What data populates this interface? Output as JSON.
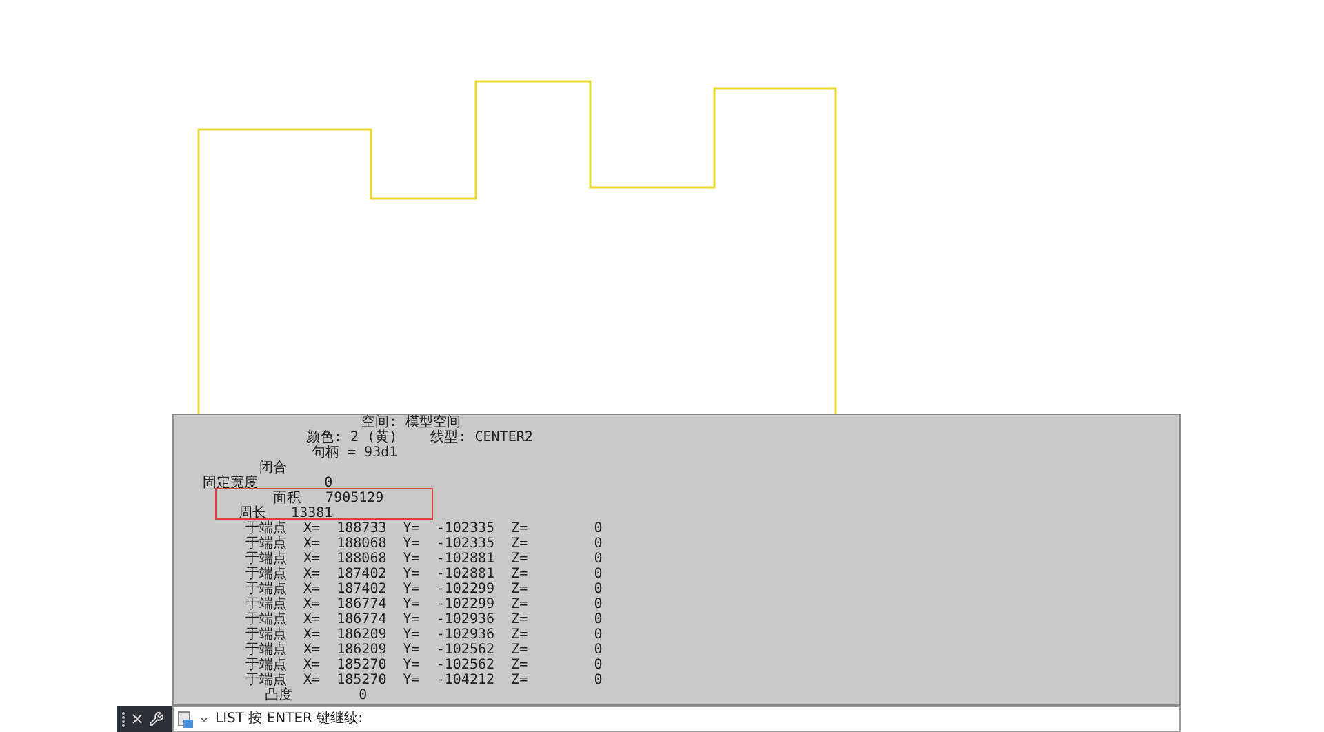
{
  "listing": {
    "lines": [
      {
        "kind": "space",
        "text": "空间: 模型空间"
      },
      {
        "kind": "color",
        "text": "颜色: 2 (黄)    线型: CENTER2"
      },
      {
        "kind": "handle",
        "text": "句柄 = 93d1"
      },
      {
        "kind": "closed",
        "text": "闭合"
      },
      {
        "kind": "width",
        "text": "固定宽度        0"
      },
      {
        "kind": "area",
        "text": "面积   7905129"
      },
      {
        "kind": "perimeter",
        "text": "周长   13381"
      },
      {
        "kind": "vertex",
        "text": "于端点  X=  188733  Y=  -102335  Z=        0"
      },
      {
        "kind": "vertex",
        "text": "于端点  X=  188068  Y=  -102335  Z=        0"
      },
      {
        "kind": "vertex",
        "text": "于端点  X=  188068  Y=  -102881  Z=        0"
      },
      {
        "kind": "vertex",
        "text": "于端点  X=  187402  Y=  -102881  Z=        0"
      },
      {
        "kind": "vertex",
        "text": "于端点  X=  187402  Y=  -102299  Z=        0"
      },
      {
        "kind": "vertex",
        "text": "于端点  X=  186774  Y=  -102299  Z=        0"
      },
      {
        "kind": "vertex",
        "text": "于端点  X=  186774  Y=  -102936  Z=        0"
      },
      {
        "kind": "vertex",
        "text": "于端点  X=  186209  Y=  -102936  Z=        0"
      },
      {
        "kind": "vertex",
        "text": "于端点  X=  186209  Y=  -102562  Z=        0"
      },
      {
        "kind": "vertex",
        "text": "于端点  X=  185270  Y=  -102562  Z=        0"
      },
      {
        "kind": "vertex",
        "text": "于端点  X=  185270  Y=  -104212  Z=        0"
      },
      {
        "kind": "bulge",
        "text": "凸度        0"
      }
    ]
  },
  "command_line": {
    "prompt": "LIST 按 ENTER 键继续:"
  }
}
